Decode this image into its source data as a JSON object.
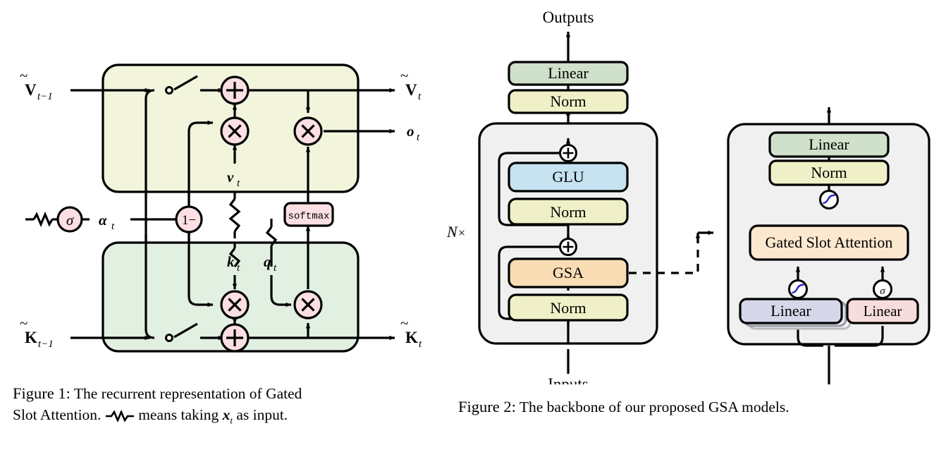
{
  "figure1": {
    "caption_label": "Figure 1:",
    "caption_text_1": "The recurrent representation of Gated",
    "caption_text_2a": "Slot Attention.",
    "caption_text_2b": "means taking",
    "caption_text_2c": "as input.",
    "caption_math_x": "x",
    "caption_math_x_sub": "t",
    "labels": {
      "v_in": "V",
      "v_in_sub": "t−1",
      "v_out": "V",
      "v_out_sub": "t",
      "k_in": "K",
      "k_in_sub": "t−1",
      "k_out": "K",
      "k_out_sub": "t",
      "o_out": "o",
      "o_out_sub": "t",
      "v_small": "v",
      "v_small_sub": "t",
      "k_small": "k",
      "k_small_sub": "t",
      "q_small": "q",
      "q_small_sub": "t",
      "alpha": "α",
      "alpha_sub": "t"
    },
    "nodes": {
      "sigma": "σ",
      "one_minus": "1−",
      "softmax": "softmax",
      "plus": "+",
      "times": "×"
    },
    "colors": {
      "value_panel": "#f2f4dc",
      "key_panel": "#e2f0e2",
      "op_node": "#fbdfe2",
      "stroke": "#000000"
    }
  },
  "figure2": {
    "caption_label": "Figure 2:",
    "caption_text": "The backbone of our proposed GSA models.",
    "io": {
      "outputs": "Outputs",
      "inputs": "Inputs"
    },
    "repeat_label": "N",
    "repeat_symbol": "×",
    "backbone_blocks": [
      {
        "label": "Linear",
        "color": "#cfe0cb"
      },
      {
        "label": "Norm",
        "color": "#f0f0c8"
      },
      {
        "label": "GLU",
        "color": "#c6e2f0"
      },
      {
        "label": "Norm",
        "color": "#f0f0c8"
      },
      {
        "label": "GSA",
        "color": "#f8dcb4"
      },
      {
        "label": "Norm",
        "color": "#f0f0c8"
      }
    ],
    "detail_blocks": [
      {
        "label": "Linear",
        "color": "#cfe0cb"
      },
      {
        "label": "Norm",
        "color": "#f0f0c8"
      },
      {
        "label": "Gated Slot Attention",
        "color": "#fbe8cf"
      },
      {
        "label": "Linear",
        "color": "#d6d8ea"
      },
      {
        "label": "Linear",
        "color": "#f7dcdc"
      }
    ],
    "activations": {
      "swish": "swish-icon",
      "sigmoid": "σ"
    },
    "residual_symbol": "⊕",
    "colors": {
      "panel": "#f0f0f0",
      "stroke": "#000000",
      "swish_curve": "#2020cc"
    }
  }
}
